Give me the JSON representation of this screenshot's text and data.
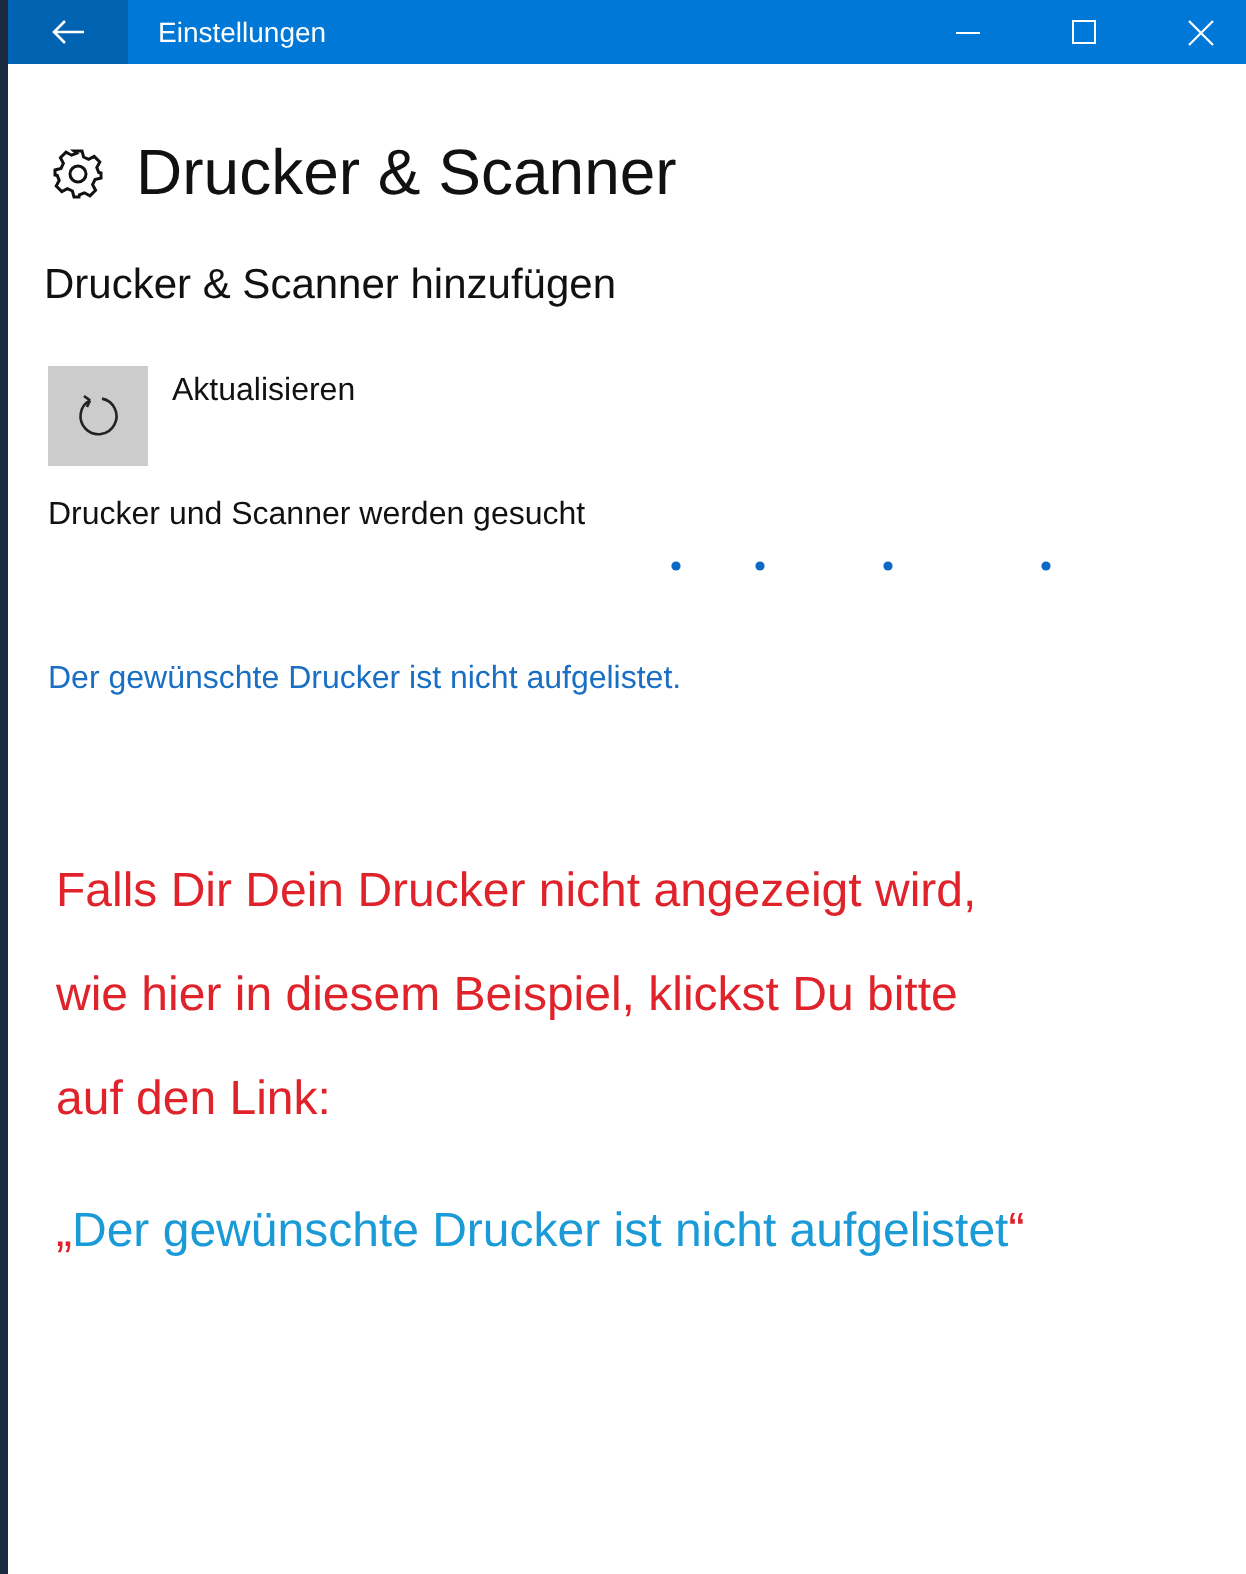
{
  "window": {
    "title": "Einstellungen"
  },
  "page": {
    "title": "Drucker & Scanner"
  },
  "section": {
    "heading": "Drucker & Scanner hinzufügen"
  },
  "refresh": {
    "label": "Aktualisieren"
  },
  "status": "Drucker und Scanner werden gesucht",
  "link": "Der gewünschte Drucker ist nicht aufgelistet.",
  "annotation": {
    "lines": [
      "Falls Dir Dein Drucker nicht angezeigt wird,",
      "wie hier in diesem Beispiel, klickst Du bitte",
      "auf den Link:"
    ],
    "quote": {
      "open": "„",
      "text": "Der gewünschte Drucker ist nicht aufgelistet",
      "close": "“"
    }
  }
}
